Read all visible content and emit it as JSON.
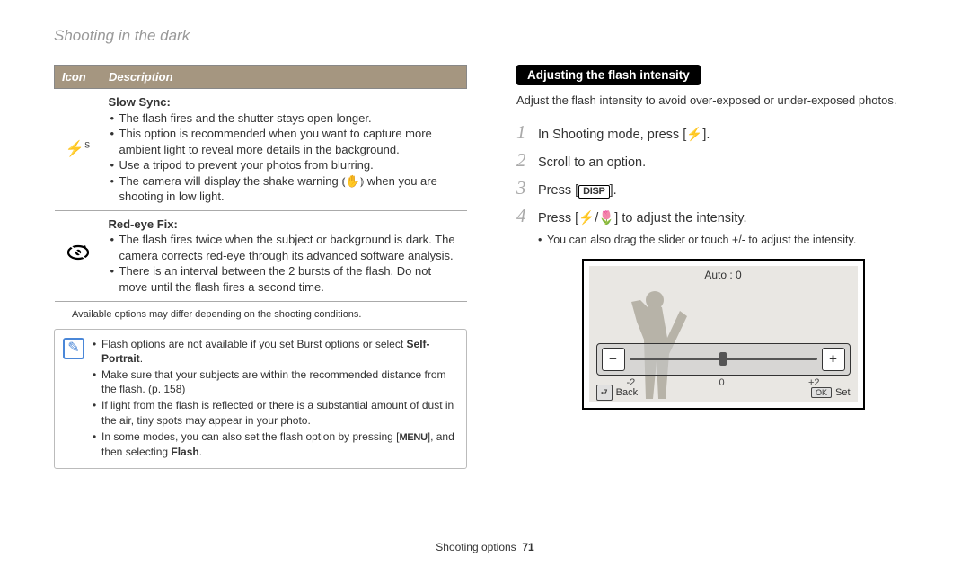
{
  "pageTitle": "Shooting in the dark",
  "table": {
    "headers": {
      "icon": "Icon",
      "desc": "Description"
    },
    "rows": [
      {
        "iconName": "flash-slow-sync-icon",
        "title": "Slow Sync",
        "bullets": [
          "The flash fires and the shutter stays open longer.",
          "This option is recommended when you want to capture more ambient light to reveal more details in the background.",
          "Use a tripod to prevent your photos from blurring.",
          "The camera will display the shake warning ⦅✋⦆ when you are shooting in low light."
        ]
      },
      {
        "iconName": "red-eye-fix-icon",
        "title": "Red-eye Fix",
        "bullets": [
          "The flash fires twice when the subject or background is dark. The camera corrects red-eye through its advanced software analysis.",
          "There is an interval between the 2 bursts of the flash. Do not move until the flash fires a second time."
        ]
      }
    ]
  },
  "footnote": "Available options may differ depending on the shooting conditions.",
  "noteBullets": [
    "Flash options are not available if you set Burst options or select Self-Portrait.",
    "Make sure that your subjects are within the recommended distance from the flash. (p. 158)",
    "If light from the flash is reflected or there is a substantial amount of dust in the air, tiny spots may appear in your photo.",
    "In some modes, you can also set the flash option by pressing [MENU], and then selecting Flash."
  ],
  "right": {
    "banner": "Adjusting the flash intensity",
    "intro": "Adjust the flash intensity to avoid over-exposed or under-exposed photos.",
    "steps": [
      "In Shooting mode, press [⚡].",
      "Scroll to an option.",
      "Press [DISP].",
      "Press [⚡/🌷] to adjust the intensity."
    ],
    "subBullet": "You can also drag the slider or touch +/- to adjust the intensity.",
    "preview": {
      "autoLabel": "Auto : 0",
      "scale": {
        "min": "-2",
        "mid": "0",
        "max": "+2"
      },
      "back": "Back",
      "set": "Set",
      "okKey": "OK"
    }
  },
  "pager": {
    "section": "Shooting options",
    "page": "71"
  }
}
